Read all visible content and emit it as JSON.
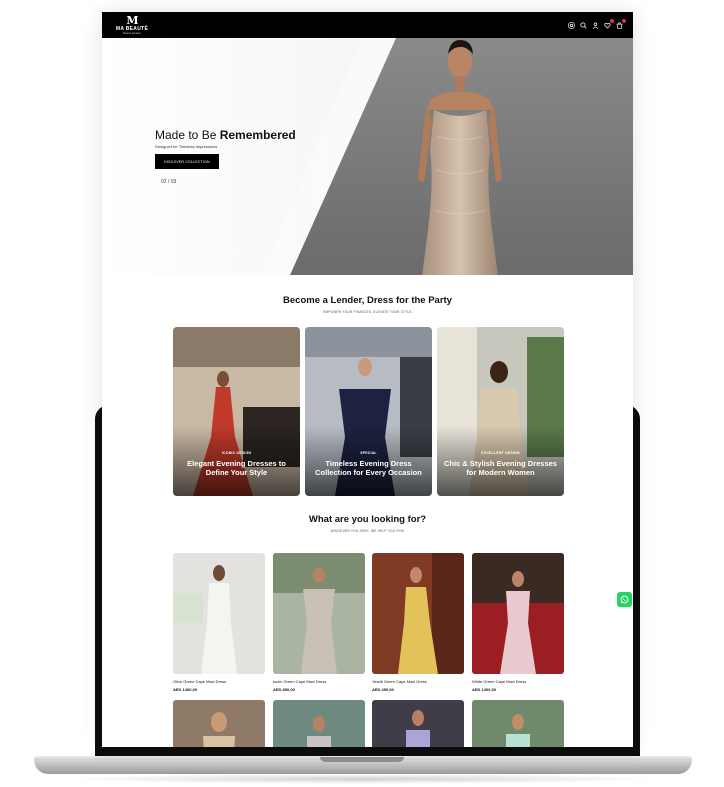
{
  "brand": {
    "mark": "M",
    "name": "MA BEAUTÉ",
    "tagline": "Beauté Couture"
  },
  "nav": {
    "icons": [
      "instagram-icon",
      "search-icon",
      "user-icon",
      "heart-icon",
      "cart-icon"
    ]
  },
  "hero": {
    "title_light": "Made to Be ",
    "title_bold": "Remembered",
    "subtitle": "Designed for Timeless Impressions",
    "button_label": "DISCOVER COLLECTION",
    "slide_counter": "02 / 03"
  },
  "lender": {
    "title": "Become a Lender, Dress for the Party",
    "subtitle": "EMPOWER YOUR FINANCES, ELEVATE YOUR STYLE",
    "cards": [
      {
        "tag": "ICONIC DESIGN",
        "title": "Elegant Evening Dresses to Define Your Style",
        "dress_color": "#c0392b",
        "bg": "#c9b8a4"
      },
      {
        "tag": "SPECIAL",
        "title": "Timeless Evening Dress Collection for Every Occasion",
        "dress_color": "#1c2240",
        "bg": "#b7bcc4"
      },
      {
        "tag": "EXCELLENT DESIGN",
        "title": "Chic & Stylish Evening Dresses for Modern Women",
        "dress_color": "#d9c9ae",
        "bg": "#c8c7bd"
      }
    ]
  },
  "looking": {
    "title": "What are you looking for?",
    "subtitle": "WHATEVER YOU SEEK, WE HELP YOU FIND",
    "products": [
      {
        "name": "Olive Green Cape Maxi Dress",
        "price": "AED 1400,00",
        "dress_color": "#f4f4f1",
        "bg": "#e4e2de"
      },
      {
        "name": "kuzin Green Cape Maxi Dress",
        "price": "AED 850,00",
        "dress_color": "#c8c0b6",
        "bg": "#a9b4a2"
      },
      {
        "name": "Yesdit Green Cape Maxi Dress",
        "price": "AED 450,00",
        "dress_color": "#e3c25a",
        "bg": "#7e3a22"
      },
      {
        "name": "White Green Cape Maxi Dress",
        "price": "AED 1400,00",
        "dress_color": "#e9c8cf",
        "bg": "#9b1e22"
      }
    ],
    "partial_products": [
      {
        "dress_color": "#d8c3a2",
        "bg": "#8e7a66"
      },
      {
        "dress_color": "#c9c3c8",
        "bg": "#6f8a7f"
      },
      {
        "dress_color": "#a7a6d6",
        "bg": "#403c48"
      },
      {
        "dress_color": "#b7e1d1",
        "bg": "#6f8a6a"
      }
    ]
  },
  "colors": {
    "accent": "#000000",
    "whatsapp": "#25d366",
    "badge": "#e02b5a"
  }
}
